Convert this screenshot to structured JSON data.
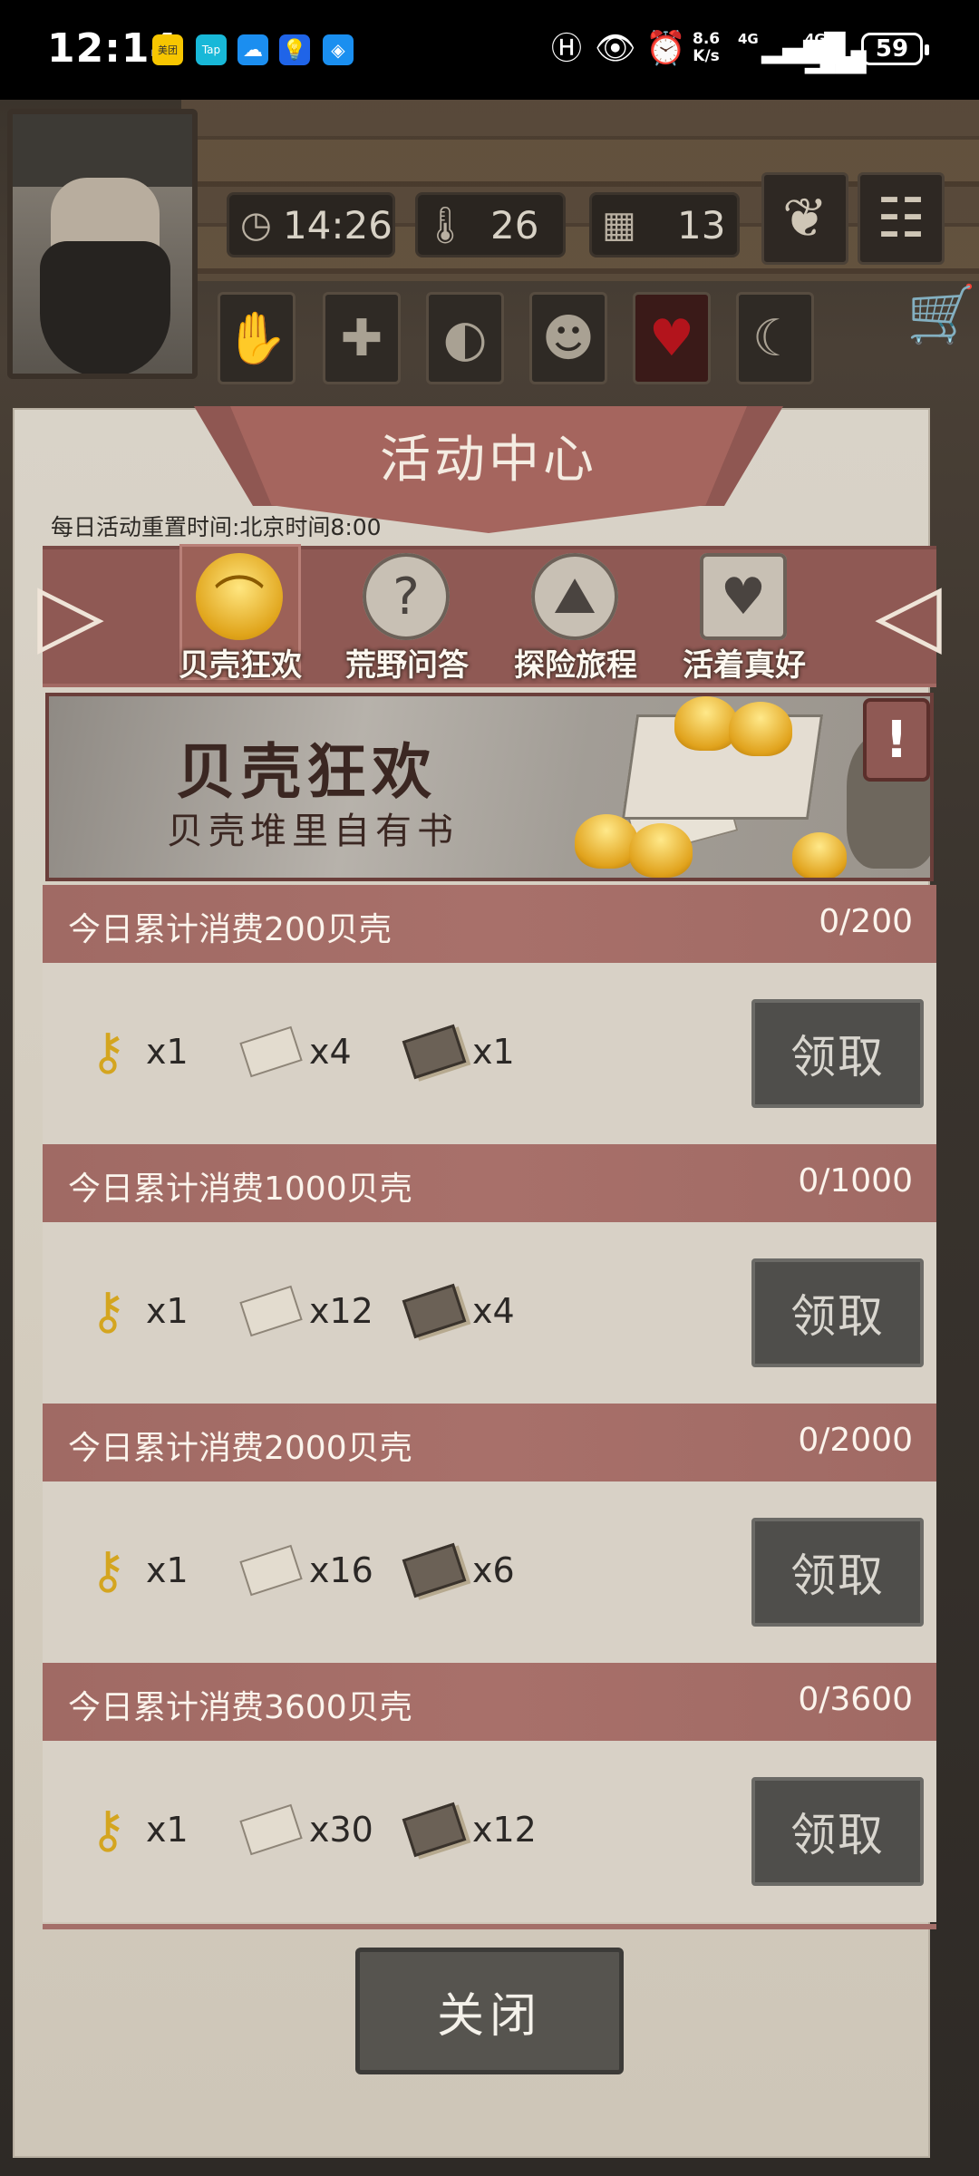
{
  "status_bar": {
    "time": "12:14",
    "net_speed": "8.6",
    "net_unit": "K/s",
    "signal_1": "4G",
    "signal_2": "4G",
    "battery": "59",
    "app_icons": [
      "meituan-icon",
      "taptap-icon",
      "cloud-icon",
      "lightbulb-icon",
      "box-icon"
    ],
    "meituan_label": "美团",
    "taptap_label": "Tap"
  },
  "hud": {
    "clock": "14:26",
    "temperature": "26",
    "day": "13"
  },
  "panel": {
    "title": "活动中心",
    "reset_text": "每日活动重置时间:北京时间8:00",
    "tabs": [
      {
        "label": "贝壳狂欢",
        "active": true
      },
      {
        "label": "荒野问答",
        "active": false
      },
      {
        "label": "探险旅程",
        "active": false
      },
      {
        "label": "活着真好",
        "active": false
      }
    ],
    "banner": {
      "title": "贝壳狂欢",
      "subtitle": "贝壳堆里自有书",
      "info_label": "!"
    },
    "rewards": [
      {
        "title": "今日累计消费200贝壳",
        "progress": "0/200",
        "items": [
          "x1",
          "x4",
          "x1"
        ],
        "button": "领取"
      },
      {
        "title": "今日累计消费1000贝壳",
        "progress": "0/1000",
        "items": [
          "x1",
          "x12",
          "x4"
        ],
        "button": "领取"
      },
      {
        "title": "今日累计消费2000贝壳",
        "progress": "0/2000",
        "items": [
          "x1",
          "x16",
          "x6"
        ],
        "button": "领取"
      },
      {
        "title": "今日累计消费3600贝壳",
        "progress": "0/3600",
        "items": [
          "x1",
          "x30",
          "x12"
        ],
        "button": "领取"
      }
    ],
    "close_label": "关闭"
  }
}
